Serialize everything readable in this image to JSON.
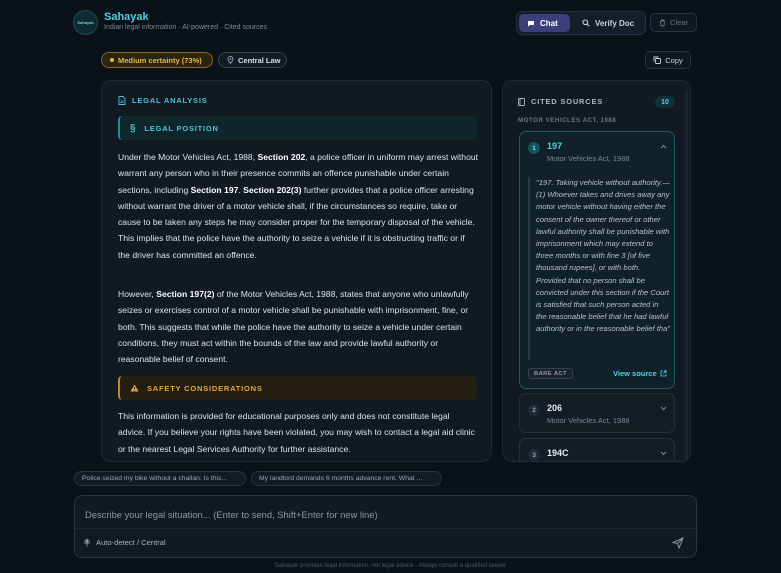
{
  "header": {
    "logo_text": "Sahayak",
    "brand": "Sahayak",
    "tagline": "Indian legal information · AI-powered · Cited sources",
    "modes": [
      {
        "label": "Chat",
        "icon": "chat-bubble-icon"
      },
      {
        "label": "Verify Doc",
        "icon": "search-icon"
      }
    ],
    "clear_label": "Clear"
  },
  "badges": {
    "certainty": "Medium certainty (73%)",
    "law": "Central Law",
    "copy": "Copy"
  },
  "analysis": {
    "title": "LEGAL ANALYSIS",
    "legal_position": "LEGAL POSITION",
    "safety": "SAFETY CONSIDERATIONS",
    "p1_a": "Under the Motor Vehicles Act, 1988, ",
    "p1_b": "Section 202",
    "p1_c": ", a police officer in uniform may arrest without warrant any person who in their presence commits an offence punishable under certain sections, including ",
    "p1_d": "Section 197",
    "p1_e": ". ",
    "p1_f": "Section 202(3)",
    "p1_g": " further provides that a police officer arresting without warrant the driver of a motor vehicle shall, if the circumstances so require, take or cause to be taken any steps he may consider proper for the temporary disposal of the vehicle. This implies that the police have the authority to seize a vehicle if it is obstructing traffic or if the driver has committed an offence.",
    "p2_a": "However, ",
    "p2_b": "Section 197(2)",
    "p2_c": " of the Motor Vehicles Act, 1988, states that anyone who unlawfully seizes or exercises control of a motor vehicle shall be punishable with imprisonment, fine, or both. This suggests that while the police have the authority to seize a vehicle under certain conditions, they must act within the bounds of the law and provide lawful authority or reasonable belief of consent.",
    "p3": "This information is provided for educational purposes only and does not constitute legal advice. If you believe your rights have been violated, you may wish to contact a legal aid clinic or the nearest Legal Services Authority for further assistance."
  },
  "sources": {
    "title": "CITED SOURCES",
    "count": "10",
    "act_label": "MOTOR VEHICLES ACT, 1988",
    "items": [
      {
        "num": "1",
        "section": "197",
        "act": "Motor Vehicles Act, 1988"
      },
      {
        "num": "2",
        "section": "206",
        "act": "Motor Vehicles Act, 1988"
      },
      {
        "num": "3",
        "section": "194C",
        "act": ""
      }
    ],
    "quote": "\"197. Taking vehicle without authority.—(1) Whoever takes and drives away any motor vehicle without having either the consent of the owner thereof or other lawful authority shall be punishable with imprisonment which may extend to three months or with fine 3 [of five thousand rupees], or with both. Provided that no person shall be convicted under this section if the Court is satisfied that such person acted in the reasonable belief that he had lawful authority or in the reasonable belief tha\"",
    "tag": "BARE ACT",
    "view_source": "View source"
  },
  "suggestions": [
    "Police seized my bike without a challan. Is this...",
    "My landlord demands 6 months advance rent. What ..."
  ],
  "input": {
    "placeholder": "Describe your legal situation... (Enter to send, Shift+Enter for new line)",
    "value": "",
    "jurisdiction": "Auto-detect / Central"
  },
  "footer": "Sahayak provides legal information, not legal advice · Always consult a qualified lawyer"
}
